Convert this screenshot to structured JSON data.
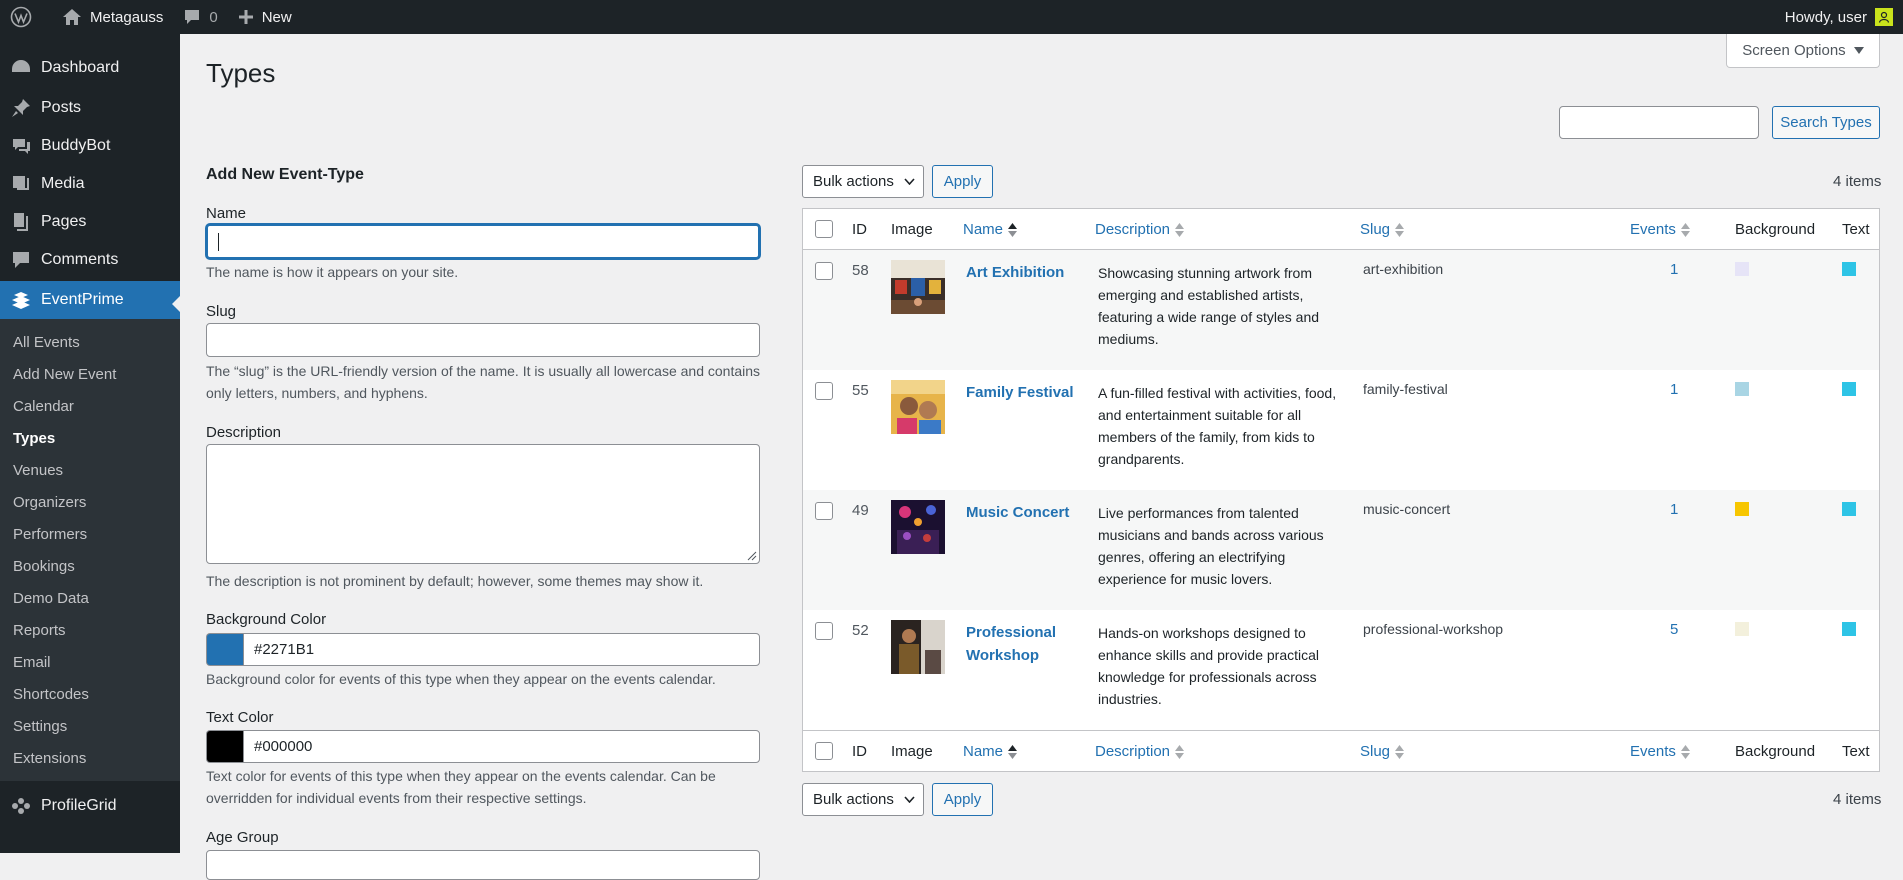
{
  "adminbar": {
    "site_name": "Metagauss",
    "comments_count": "0",
    "new_label": "New",
    "howdy": "Howdy, user"
  },
  "sidebar": {
    "top_items": [
      {
        "label": "Dashboard",
        "icon": "dashboard-icon"
      },
      {
        "label": "Posts",
        "icon": "pin-icon"
      },
      {
        "label": "BuddyBot",
        "icon": "chat-icon"
      },
      {
        "label": "Media",
        "icon": "media-icon"
      },
      {
        "label": "Pages",
        "icon": "pages-icon"
      },
      {
        "label": "Comments",
        "icon": "comment-icon"
      },
      {
        "label": "EventPrime",
        "icon": "eventprime-icon"
      }
    ],
    "sub_items": [
      "All Events",
      "Add New Event",
      "Calendar",
      "Types",
      "Venues",
      "Organizers",
      "Performers",
      "Bookings",
      "Demo Data",
      "Reports",
      "Email",
      "Shortcodes",
      "Settings",
      "Extensions"
    ],
    "current_sub": "Types",
    "bottom_item": {
      "label": "ProfileGrid",
      "icon": "profilegrid-icon"
    }
  },
  "screen_options": "Screen Options",
  "page_title": "Types",
  "search": {
    "button": "Search Types",
    "value": ""
  },
  "form": {
    "heading": "Add New Event-Type",
    "name_label": "Name",
    "name_help": "The name is how it appears on your site.",
    "slug_label": "Slug",
    "slug_help": "The “slug” is the URL-friendly version of the name. It is usually all lowercase and contains only letters, numbers, and hyphens.",
    "description_label": "Description",
    "description_help": "The description is not prominent by default; however, some themes may show it.",
    "bg_color_label": "Background Color",
    "bg_color_value": "#2271B1",
    "bg_color_help": "Background color for events of this type when they appear on the events calendar.",
    "text_color_label": "Text Color",
    "text_color_value": "#000000",
    "text_color_help": "Text color for events of this type when they appear on the events calendar. Can be overridden for individual events from their respective settings.",
    "age_group_label": "Age Group"
  },
  "list": {
    "bulk_actions": "Bulk actions",
    "apply": "Apply",
    "items_count": "4 items",
    "columns": {
      "id": "ID",
      "image": "Image",
      "name": "Name",
      "description": "Description",
      "slug": "Slug",
      "events": "Events",
      "background": "Background",
      "text": "Text"
    },
    "rows": [
      {
        "id": "58",
        "name": "Art Exhibition",
        "description": "Showcasing stunning artwork from emerging and established artists, featuring a wide range of styles and mediums.",
        "slug": "art-exhibition",
        "events": "1",
        "background": "#e6e4f7",
        "text": "#2ec4e6"
      },
      {
        "id": "55",
        "name": "Family Festival",
        "description": "A fun-filled festival with activities, food, and entertainment suitable for all members of the family, from kids to grandparents.",
        "slug": "family-festival",
        "events": "1",
        "background": "#a9d5e4",
        "text": "#2ec4e6"
      },
      {
        "id": "49",
        "name": "Music Concert",
        "description": "Live performances from talented musicians and bands across various genres, offering an electrifying experience for music lovers.",
        "slug": "music-concert",
        "events": "1",
        "background": "#f7c600",
        "text": "#2ec4e6"
      },
      {
        "id": "52",
        "name": "Professional Workshop",
        "description": "Hands-on workshops designed to enhance skills and provide practical knowledge for professionals across industries.",
        "slug": "professional-workshop",
        "events": "5",
        "background": "#f3f0dc",
        "text": "#2ec4e6"
      }
    ]
  },
  "colors": {
    "accent": "#2271b1",
    "admin_dark": "#1d2327"
  }
}
